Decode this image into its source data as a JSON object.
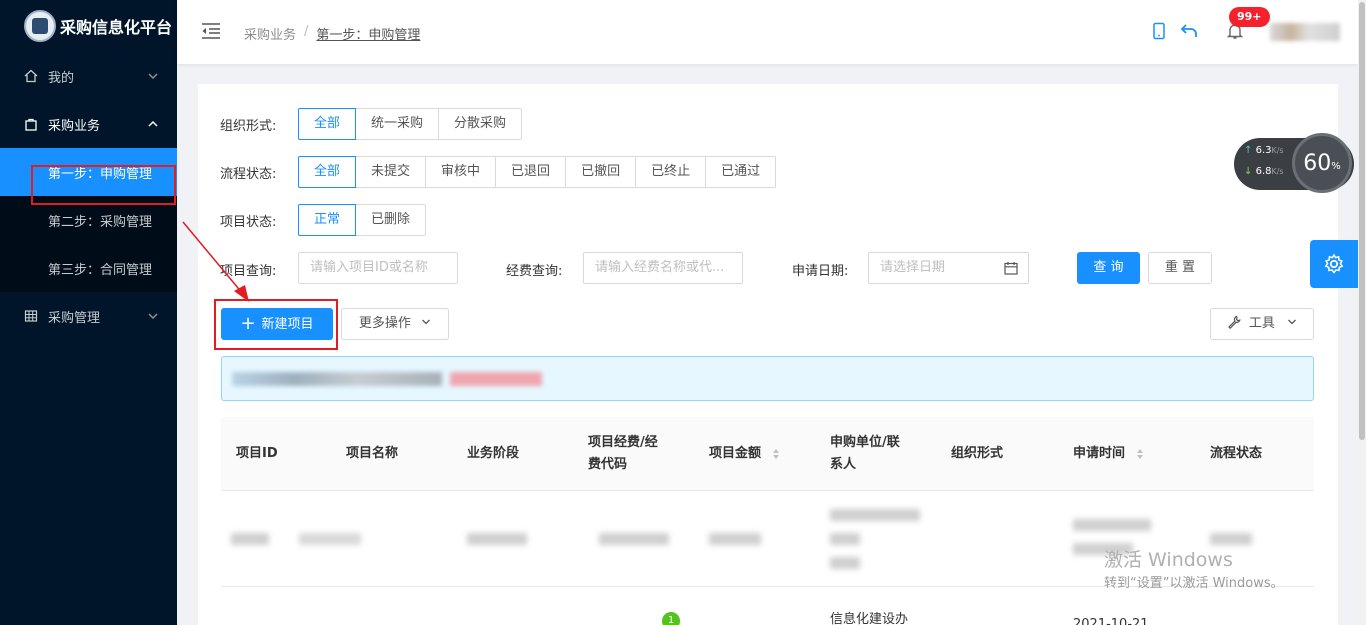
{
  "app": {
    "title": "采购信息化平台"
  },
  "sidebar": {
    "items": [
      {
        "label": "我的",
        "icon": "home-icon"
      },
      {
        "label": "采购业务",
        "icon": "shopping-bag-icon"
      },
      {
        "label": "采购管理",
        "icon": "table-icon"
      }
    ],
    "sub_items": [
      {
        "label": "第一步：申购管理"
      },
      {
        "label": "第二步：采购管理"
      },
      {
        "label": "第三步：合同管理"
      }
    ]
  },
  "header": {
    "breadcrumb": {
      "parent": "采购业务",
      "separator": "/",
      "current": "第一步：申购管理"
    },
    "notification_badge": "99+"
  },
  "filters": {
    "org": {
      "label": "组织形式:",
      "options": [
        "全部",
        "统一采购",
        "分散采购"
      ]
    },
    "flow": {
      "label": "流程状态:",
      "options": [
        "全部",
        "未提交",
        "审核中",
        "已退回",
        "已撤回",
        "已终止",
        "已通过"
      ]
    },
    "project": {
      "label": "项目状态:",
      "options": [
        "正常",
        "已删除"
      ]
    }
  },
  "search": {
    "project_label": "项目查询:",
    "project_placeholder": "请输入项目ID或名称",
    "fund_label": "经费查询:",
    "fund_placeholder": "请输入经费名称或代...",
    "date_label": "申请日期:",
    "date_placeholder": "请选择日期",
    "query_button": "查 询",
    "reset_button": "重 置"
  },
  "actions": {
    "new_project": "新建项目",
    "more_ops": "更多操作",
    "tools": "工具"
  },
  "table": {
    "headers": [
      {
        "label": "项目ID"
      },
      {
        "label": "项目名称"
      },
      {
        "label": "业务阶段"
      },
      {
        "label": "项目经费/经费代码"
      },
      {
        "label": "项目金额"
      },
      {
        "label": "申购单位/联系人"
      },
      {
        "label": "组织形式"
      },
      {
        "label": "申请时间"
      },
      {
        "label": "流程状态"
      }
    ],
    "row2": {
      "unit": "信息化建设办",
      "time": "2021-10-21",
      "step_badge": "1"
    }
  },
  "widgets": {
    "upload_speed": "6.3",
    "download_speed": "6.8",
    "speed_unit": "K/s",
    "cpu_value": "60",
    "cpu_unit": "%"
  },
  "watermark": {
    "line1": "激活 Windows",
    "line2": "转到“设置”以激活 Windows。"
  },
  "colors": {
    "primary": "#1890ff",
    "sidebar": "#001529",
    "highlight": "#e31b23"
  }
}
